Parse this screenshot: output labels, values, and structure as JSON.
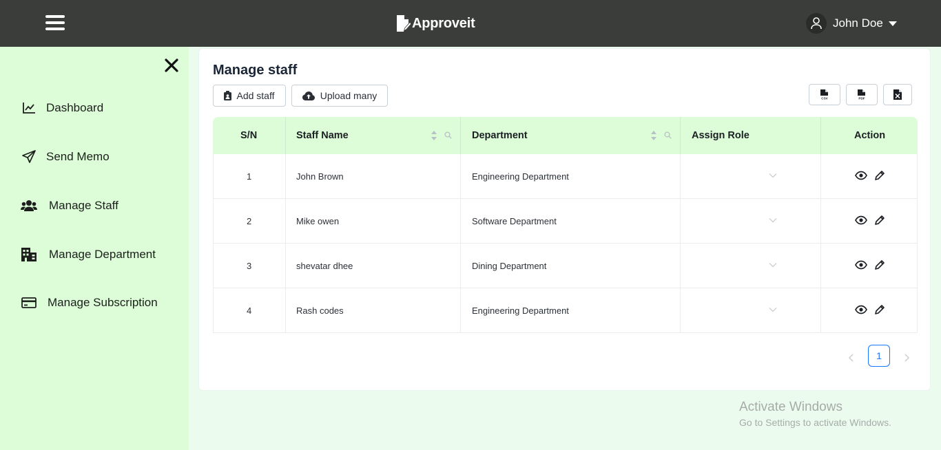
{
  "header": {
    "brand": "Approveit",
    "user_name": "John Doe"
  },
  "sidebar": {
    "items": [
      {
        "label": "Dashboard",
        "icon": "chart-line-icon"
      },
      {
        "label": "Send Memo",
        "icon": "paper-plane-icon"
      },
      {
        "label": "Manage Staff",
        "icon": "users-icon"
      },
      {
        "label": "Manage Department",
        "icon": "building-icon"
      },
      {
        "label": "Manage Subscription",
        "icon": "credit-card-icon"
      }
    ]
  },
  "main": {
    "title": "Manage staff",
    "add_staff_label": "Add staff",
    "upload_many_label": "Upload many",
    "export_buttons": [
      "csv-file-icon",
      "pdf-file-icon",
      "excel-file-icon"
    ]
  },
  "table": {
    "columns": [
      "S/N",
      "Staff Name",
      "Department",
      "Assign Role",
      "Action"
    ],
    "rows": [
      {
        "sn": "1",
        "name": "John Brown",
        "department": "Engineering Department"
      },
      {
        "sn": "2",
        "name": "Mike owen",
        "department": "Software Department"
      },
      {
        "sn": "3",
        "name": "shevatar dhee",
        "department": "Dining Department"
      },
      {
        "sn": "4",
        "name": "Rash codes",
        "department": "Engineering Department"
      }
    ]
  },
  "pagination": {
    "current_page": "1"
  },
  "watermark": {
    "title": "Activate Windows",
    "subtitle": "Go to Settings to activate Windows."
  },
  "colors": {
    "topbar": "#3a3d39",
    "sidebar": "#dcfdd7",
    "background": "#ebfcef",
    "accent": "#1677ff"
  }
}
